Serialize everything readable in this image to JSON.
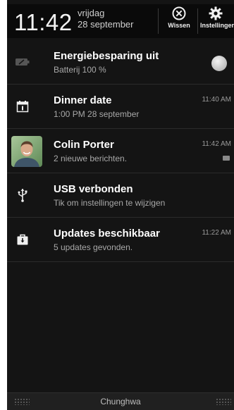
{
  "header": {
    "time": "11:42",
    "day": "vrijdag",
    "date": "28 september",
    "clear_label": "Wissen",
    "settings_label": "Instellingen"
  },
  "notifications": [
    {
      "title": "Energiebesparing uit",
      "subtitle": "Batterij 100 %",
      "time": "",
      "icon": "battery-saver-icon"
    },
    {
      "title": "Dinner date",
      "subtitle": "1:00 PM 28 september",
      "time": "11:40 AM",
      "icon": "calendar-icon"
    },
    {
      "title": "Colin Porter",
      "subtitle": "2 nieuwe berichten.",
      "time": "11:42 AM",
      "icon": "contact-avatar"
    },
    {
      "title": "USB verbonden",
      "subtitle": "Tik om instellingen te wijzigen",
      "time": "",
      "icon": "usb-icon"
    },
    {
      "title": "Updates beschikbaar",
      "subtitle": "5 updates gevonden.",
      "time": "11:22 AM",
      "icon": "update-icon"
    }
  ],
  "footer": {
    "carrier": "Chunghwa"
  },
  "colors": {
    "background": "#141414",
    "header": "#0a0a0a",
    "title_text": "#ffffff",
    "subtitle_text": "#a8a8a8"
  }
}
